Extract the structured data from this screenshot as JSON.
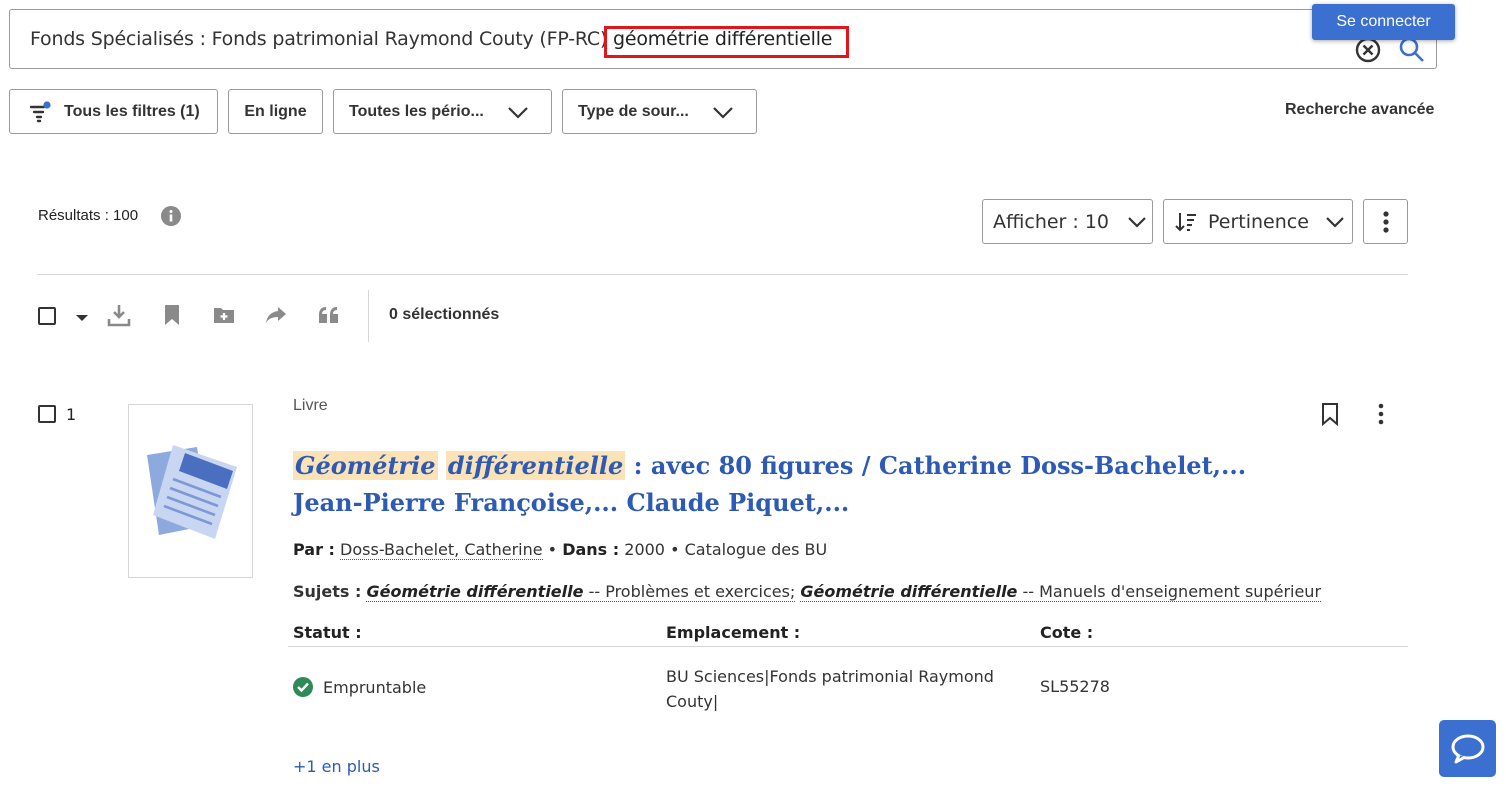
{
  "search": {
    "prefix": "Fonds Spécialisés : Fonds patrimonial Raymond Couty (FP-RC)",
    "query": "géométrie différentielle"
  },
  "header": {
    "connect_label": "Se connecter"
  },
  "filters": {
    "all_filters": "Tous les filtres (1)",
    "online": "En ligne",
    "periods": "Toutes les pério...",
    "source_type": "Type de sour...",
    "advanced": "Recherche avancée"
  },
  "results": {
    "count": "Résultats : 100",
    "per_page": "Afficher : 10",
    "sort": "Pertinence",
    "selected": "0 sélectionnés"
  },
  "icons": {
    "filter": "filter-icon",
    "search": "search-icon",
    "clear": "clear-icon",
    "download": "download-icon",
    "bookmark": "bookmark-icon",
    "folder_add": "folder-add-icon",
    "share": "share-icon",
    "quote": "quote-icon",
    "kebab": "kebab-icon",
    "chat": "chat-icon"
  },
  "colors": {
    "accent": "#3b6fd0",
    "link": "#2c5ab5",
    "highlight": "#fbe2b7",
    "box": "#e0161b",
    "ok": "#2e8b57"
  },
  "item": {
    "number": "1",
    "type": "Livre",
    "title_hl1": "Géométrie",
    "title_hl2": "différentielle",
    "title_rest": " : avec 80 figures / Catherine Doss-Bachelet,... Jean-Pierre Françoise,... Claude Piquet,...",
    "by_label": "Par :",
    "author": "Doss-Bachelet, Catherine",
    "in_label": "Dans :",
    "year": "2000",
    "catalog": "Catalogue des BU",
    "subjects_label": "Sujets :",
    "subject1_em": "Géométrie différentielle",
    "subject1_rest": " -- Problèmes et exercices;",
    "subject2_em": "Géométrie différentielle",
    "subject2_rest": " -- Manuels d'enseignement supérieur",
    "col_status": "Statut :",
    "col_location": "Emplacement :",
    "col_cote": "Cote :",
    "status": "Empruntable",
    "location": "BU Sciences|Fonds patrimonial Raymond Couty|",
    "cote": "SL55278",
    "more": "+1 en plus"
  }
}
